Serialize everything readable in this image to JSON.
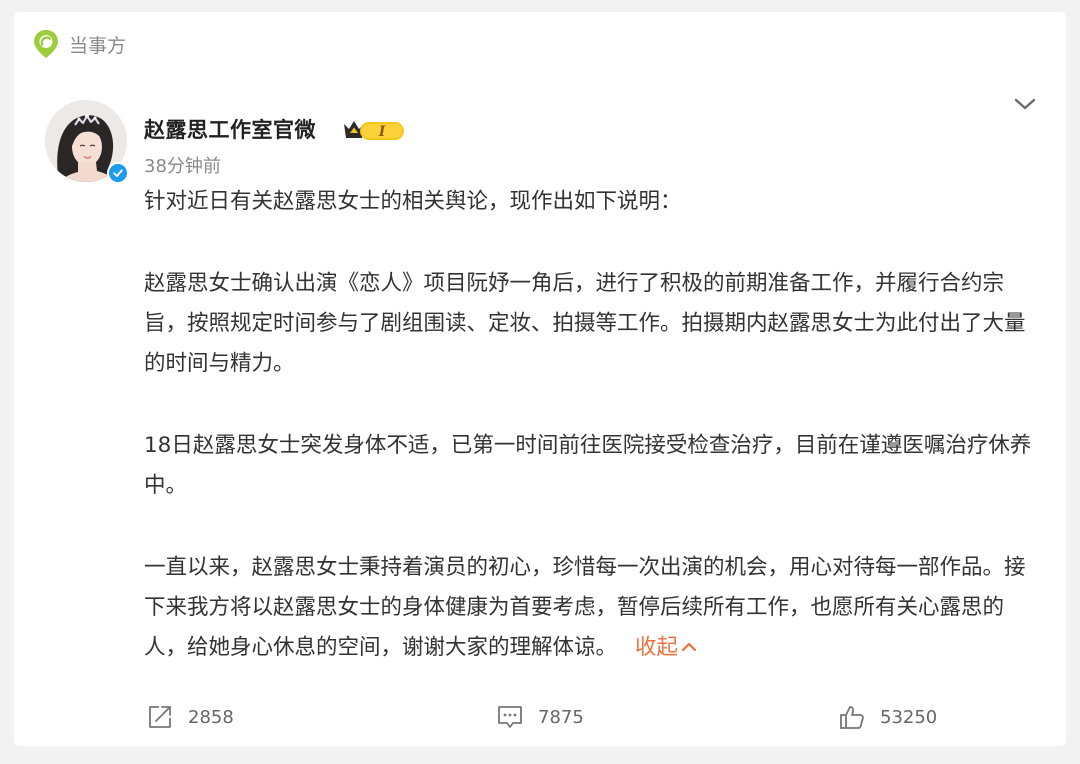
{
  "tag": {
    "label": "当事方",
    "icon": "location-pin-icon",
    "color": "#9ccd3c"
  },
  "author": {
    "name": "赵露思工作室官微",
    "verified": true,
    "verified_color": "#1d9bf0",
    "level_badge_text": "I"
  },
  "post": {
    "time": "38分钟前",
    "paragraphs": [
      "针对近日有关赵露思女士的相关舆论，现作出如下说明：",
      "赵露思女士确认出演《恋人》项目阮妤一角后，进行了积极的前期准备工作，并履行合约宗旨，按照规定时间参与了剧组围读、定妆、拍摄等工作。拍摄期内赵露思女士为此付出了大量的时间与精力。",
      "18日赵露思女士突发身体不适，已第一时间前往医院接受检查治疗，目前在谨遵医嘱治疗休养中。",
      "一直以来，赵露思女士秉持着演员的初心，珍惜每一次出演的机会，用心对待每一部作品。接下来我方将以赵露思女士的身体健康为首要考虑，暂停后续所有工作，也愿所有关心露思的人，给她身心休息的空间，谢谢大家的理解体谅。"
    ],
    "collapse_label": "收起",
    "accent_color": "#eb7340"
  },
  "actions": {
    "share": {
      "icon": "share-icon",
      "count": "2858"
    },
    "comment": {
      "icon": "comment-icon",
      "count": "7875"
    },
    "like": {
      "icon": "thumbs-up-icon",
      "count": "53250"
    }
  }
}
